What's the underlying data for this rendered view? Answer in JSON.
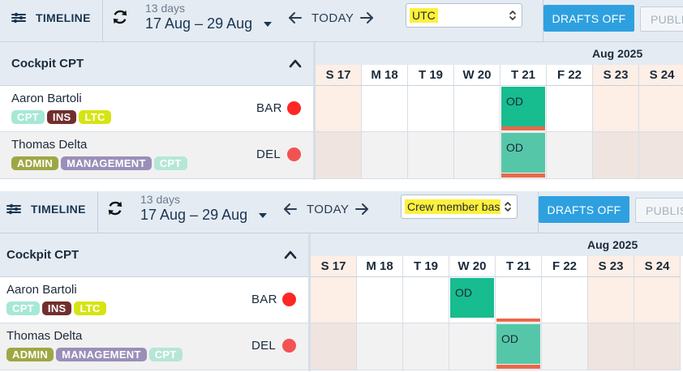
{
  "colors": {
    "accent": "#2ea0e0",
    "status_red": "#ff2626",
    "status_red_soft": "#f35252",
    "highlight": "#fff03a",
    "duty_green": "#17bc8f",
    "duty_green_pale": "#55c7a8",
    "duty_strip": "#e8694a"
  },
  "icons": {
    "timeline": "sliders-icon",
    "refresh": "refresh-icon",
    "prev": "arrow-left-icon",
    "next": "arrow-right-icon",
    "collapse": "chevron-up-icon",
    "select": "updown-caret-icon"
  },
  "panels": [
    {
      "toolbar": {
        "timeline_label": "TIMELINE",
        "range_days": "13 days",
        "range_dates": "17 Aug – 29 Aug",
        "today_label": "TODAY",
        "select_value": "UTC",
        "drafts_label": "DRAFTS OFF",
        "publish_label": "PUBLISH"
      },
      "group": {
        "label": "Cockpit CPT"
      },
      "month_label": "Aug 2025",
      "days": [
        {
          "label": "S 17",
          "weekend": true
        },
        {
          "label": "M 18",
          "weekend": false
        },
        {
          "label": "T 19",
          "weekend": false
        },
        {
          "label": "W 20",
          "weekend": false
        },
        {
          "label": "T 21",
          "weekend": false
        },
        {
          "label": "F 22",
          "weekend": false
        },
        {
          "label": "S 23",
          "weekend": true
        },
        {
          "label": "S 24",
          "weekend": true
        }
      ],
      "crew": [
        {
          "name": "Aaron Bartoli",
          "code": "BAR",
          "status_color": "#ff2626",
          "tags": [
            {
              "label": "CPT",
              "color": "#a6e8d5"
            },
            {
              "label": "INS",
              "color": "#722e2e"
            },
            {
              "label": "LTC",
              "color": "#d6e413"
            }
          ],
          "duties": [
            {
              "day": 4,
              "label": "OD",
              "style": "solid",
              "strip": true
            }
          ]
        },
        {
          "name": "Thomas Delta",
          "code": "DEL",
          "status_color": "#f35252",
          "tags": [
            {
              "label": "ADMIN",
              "color": "#9ea744"
            },
            {
              "label": "MANAGEMENT",
              "color": "#9a8fb8"
            },
            {
              "label": "CPT",
              "color": "#b6e6d7"
            }
          ],
          "duties": [
            {
              "day": 4,
              "label": "OD",
              "style": "pale",
              "strip": true
            }
          ]
        }
      ]
    },
    {
      "toolbar": {
        "timeline_label": "TIMELINE",
        "range_days": "13 days",
        "range_dates": "17 Aug – 29 Aug",
        "today_label": "TODAY",
        "select_value": "Crew member bas",
        "drafts_label": "DRAFTS OFF",
        "publish_label": "PUBLISH"
      },
      "group": {
        "label": "Cockpit CPT"
      },
      "month_label": "Aug 2025",
      "days": [
        {
          "label": "S 17",
          "weekend": true
        },
        {
          "label": "M 18",
          "weekend": false
        },
        {
          "label": "T 19",
          "weekend": false
        },
        {
          "label": "W 20",
          "weekend": false
        },
        {
          "label": "T 21",
          "weekend": false
        },
        {
          "label": "F 22",
          "weekend": false
        },
        {
          "label": "S 23",
          "weekend": true
        },
        {
          "label": "S 24",
          "weekend": true
        }
      ],
      "crew": [
        {
          "name": "Aaron Bartoli",
          "code": "BAR",
          "status_color": "#ff2626",
          "tags": [
            {
              "label": "CPT",
              "color": "#a6e8d5"
            },
            {
              "label": "INS",
              "color": "#722e2e"
            },
            {
              "label": "LTC",
              "color": "#d6e413"
            }
          ],
          "duties": [
            {
              "day": 3,
              "label": "OD",
              "style": "solid",
              "strip": false
            },
            {
              "day": 4,
              "label": "",
              "style": "none",
              "strip": true
            }
          ]
        },
        {
          "name": "Thomas Delta",
          "code": "DEL",
          "status_color": "#f35252",
          "tags": [
            {
              "label": "ADMIN",
              "color": "#9ea744"
            },
            {
              "label": "MANAGEMENT",
              "color": "#9a8fb8"
            },
            {
              "label": "CPT",
              "color": "#b6e6d7"
            }
          ],
          "duties": [
            {
              "day": 4,
              "label": "OD",
              "style": "pale",
              "strip": true
            }
          ]
        }
      ]
    }
  ]
}
